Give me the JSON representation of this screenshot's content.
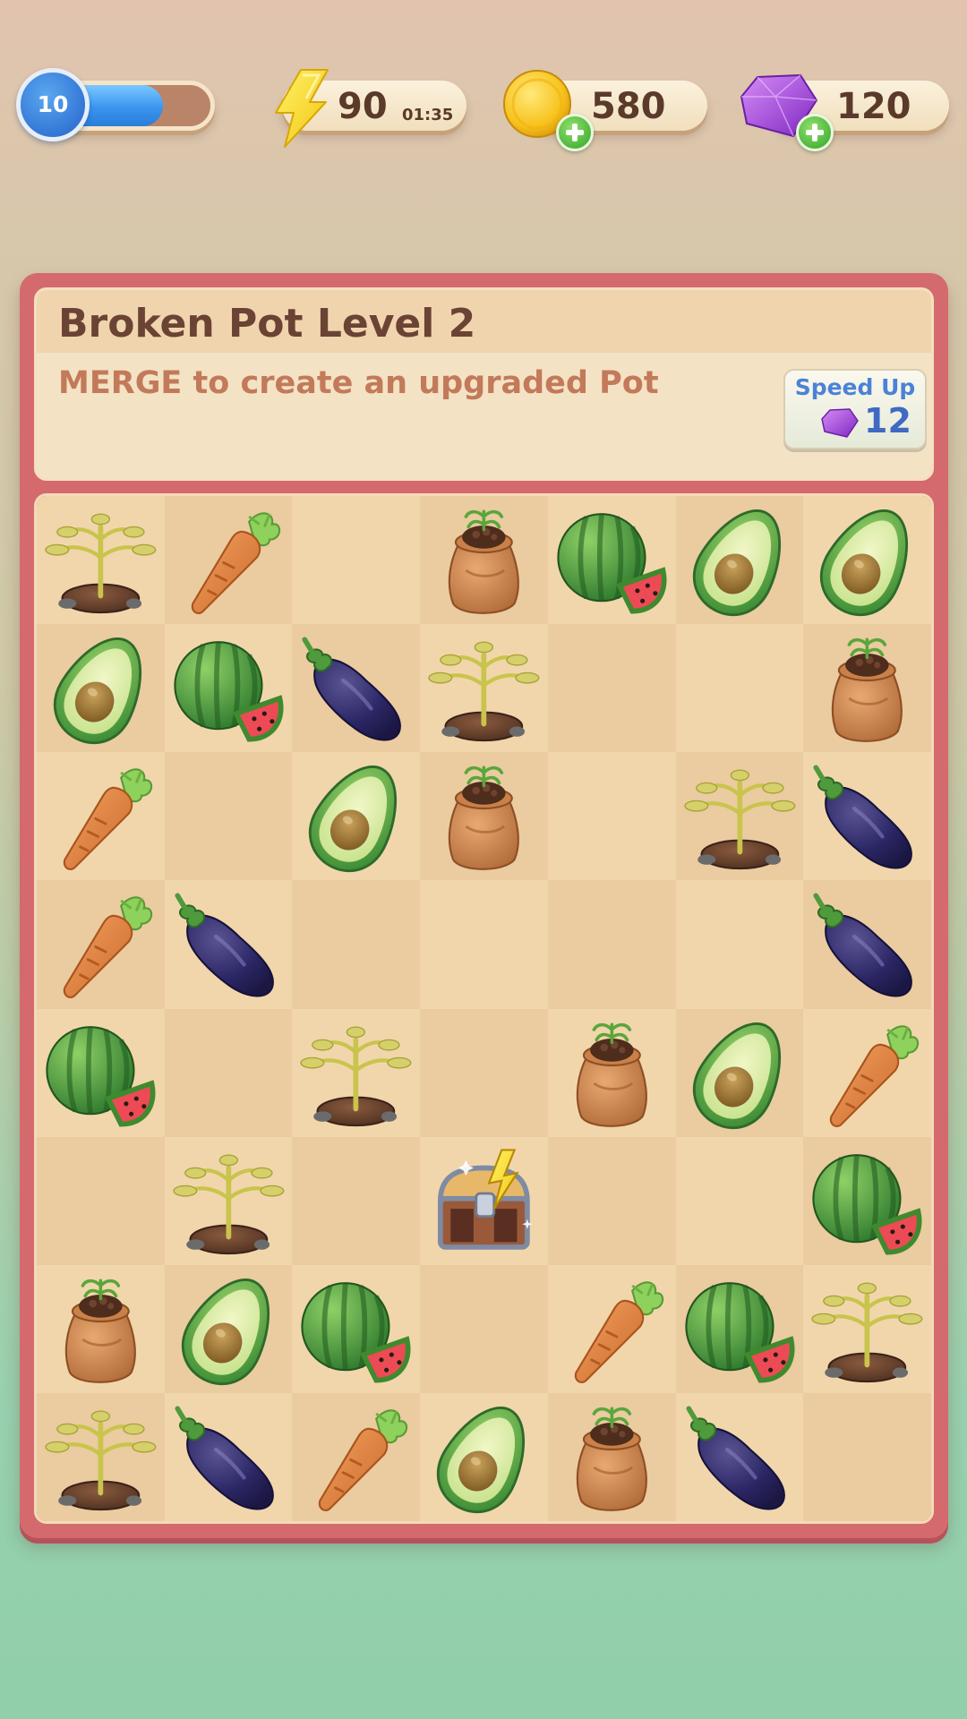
{
  "hud": {
    "level": "10",
    "level_progress": 0.7,
    "energy": "90",
    "energy_timer": "01:35",
    "coins": "580",
    "gems": "120"
  },
  "info": {
    "title": "Broken Pot Level 2",
    "description": "MERGE to create an upgraded Pot",
    "speed_up_label": "Speed Up",
    "speed_up_cost": "12"
  },
  "board": {
    "rows": [
      [
        "sprout",
        "carrot",
        "",
        "seed-bag",
        "watermelon",
        "avocado",
        "avocado"
      ],
      [
        "avocado",
        "watermelon",
        "eggplant",
        "sprout",
        "",
        "",
        "seed-bag"
      ],
      [
        "carrot",
        "",
        "avocado",
        "seed-bag",
        "",
        "sprout",
        "eggplant"
      ],
      [
        "carrot",
        "eggplant",
        "",
        "",
        "",
        "",
        "eggplant"
      ],
      [
        "watermelon",
        "",
        "sprout",
        "",
        "seed-bag",
        "avocado",
        "carrot"
      ],
      [
        "",
        "sprout",
        "",
        "treasure-chest",
        "",
        "",
        "watermelon"
      ],
      [
        "seed-bag",
        "avocado",
        "watermelon",
        "",
        "carrot",
        "watermelon",
        "sprout"
      ],
      [
        "sprout",
        "eggplant",
        "carrot",
        "avocado",
        "seed-bag",
        "eggplant",
        ""
      ]
    ]
  }
}
